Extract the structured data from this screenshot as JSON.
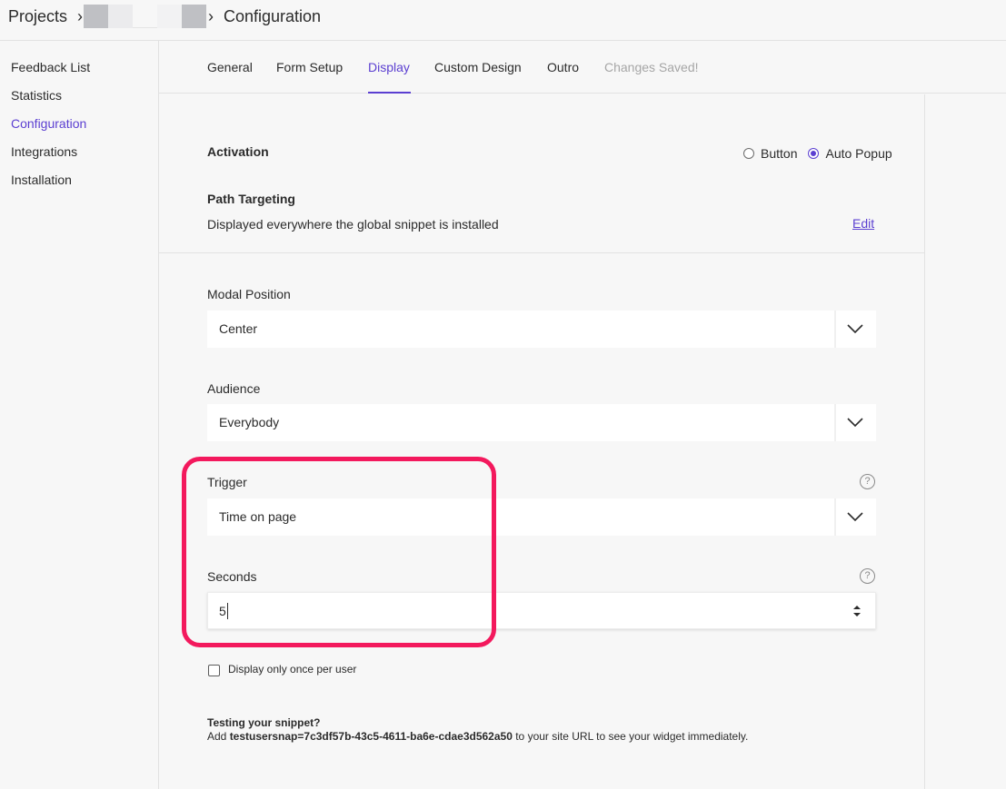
{
  "breadcrumb": {
    "root": "Projects",
    "separator": "›",
    "current": "Configuration"
  },
  "sidebar": {
    "items": [
      {
        "label": "Feedback List"
      },
      {
        "label": "Statistics"
      },
      {
        "label": "Configuration"
      },
      {
        "label": "Integrations"
      },
      {
        "label": "Installation"
      }
    ],
    "active_index": 2
  },
  "tabs": {
    "items": [
      {
        "label": "General"
      },
      {
        "label": "Form Setup"
      },
      {
        "label": "Display"
      },
      {
        "label": "Custom Design"
      },
      {
        "label": "Outro"
      }
    ],
    "active_index": 2,
    "status": "Changes Saved!"
  },
  "activation": {
    "label": "Activation",
    "options": [
      {
        "label": "Button",
        "checked": false
      },
      {
        "label": "Auto Popup",
        "checked": true
      }
    ]
  },
  "path_targeting": {
    "label": "Path Targeting",
    "description": "Displayed everywhere the global snippet is installed",
    "edit_label": "Edit"
  },
  "modal_position": {
    "label": "Modal Position",
    "value": "Center"
  },
  "audience": {
    "label": "Audience",
    "value": "Everybody"
  },
  "trigger": {
    "label": "Trigger",
    "value": "Time on page",
    "help_icon": "question-circle-icon"
  },
  "seconds": {
    "label": "Seconds",
    "value": "5",
    "help_icon": "question-circle-icon"
  },
  "display_once": {
    "label": "Display only once per user",
    "checked": false
  },
  "testing": {
    "title": "Testing your snippet?",
    "prefix": "Add ",
    "code": "testusersnap=7c3df57b-43c5-4611-ba6e-cdae3d562a50",
    "suffix": " to your site URL to see your widget immediately."
  },
  "colors": {
    "accent": "#5b3fd1",
    "highlight": "#f3195d",
    "background": "#f7f7f7"
  }
}
